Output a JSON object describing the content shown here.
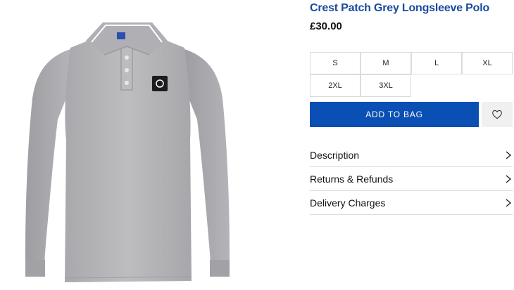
{
  "product": {
    "title": "Crest Patch Grey Longsleeve Polo",
    "price": "£30.00"
  },
  "sizes": [
    "S",
    "M",
    "L",
    "XL",
    "2XL",
    "3XL"
  ],
  "actions": {
    "add_to_bag": "ADD TO BAG"
  },
  "accordion": [
    {
      "label": "Description"
    },
    {
      "label": "Returns & Refunds"
    },
    {
      "label": "Delivery Charges"
    }
  ],
  "colors": {
    "title": "#1a4aa0",
    "add_button": "#0a4fb3",
    "shirt": "#b8b8bb",
    "border": "#dcdcdc"
  },
  "icons": [
    "polo-shirt-image",
    "heart-icon",
    "chevron-right-icon"
  ]
}
